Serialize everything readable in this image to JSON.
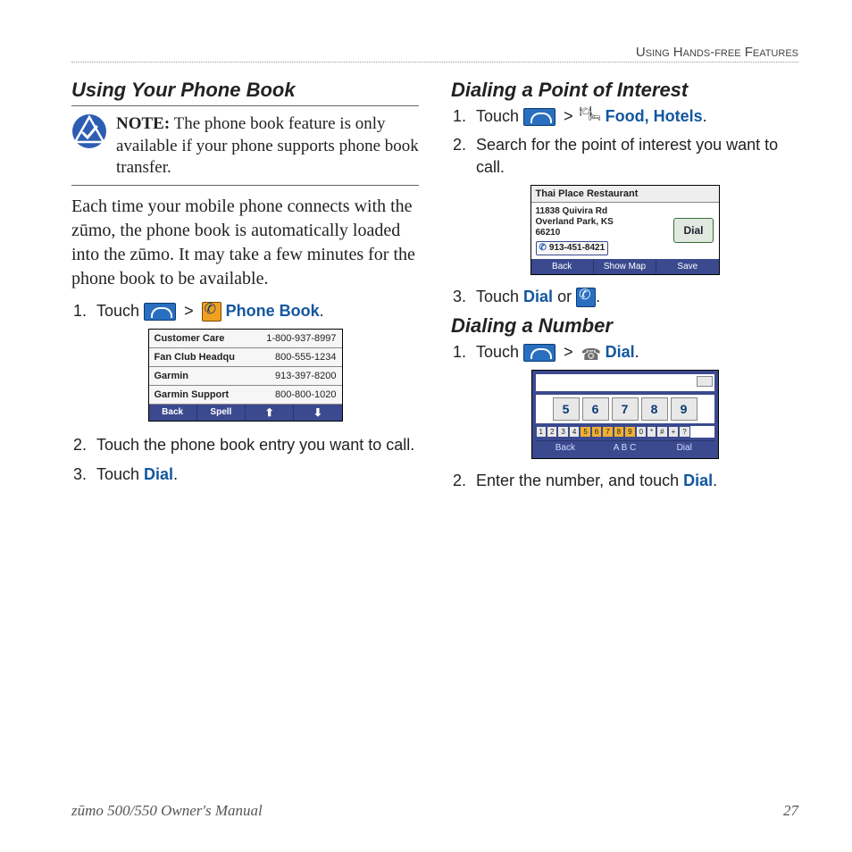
{
  "running_head": "Using Hands-free Features",
  "left": {
    "heading": "Using Your Phone Book",
    "note_label": "NOTE:",
    "note_text": " The phone book feature is only available if your phone supports phone book transfer.",
    "para": "Each time your mobile phone connects with the zūmo, the phone book is automatically loaded into the zūmo. It may take a few minutes for the phone book to be available.",
    "step1_touch": "Touch ",
    "step1_link": " Phone Book",
    "step1_period": ".",
    "step2": "Touch the phone book entry you want to call.",
    "step3_a": "Touch ",
    "step3_link": "Dial",
    "step3_b": "."
  },
  "phonebook_screenshot": {
    "rows": [
      {
        "name": "Customer Care",
        "num": "1-800-937-8997"
      },
      {
        "name": "Fan Club Headqu",
        "num": "800-555-1234"
      },
      {
        "name": "Garmin",
        "num": "913-397-8200"
      },
      {
        "name": "Garmin Support",
        "num": "800-800-1020"
      }
    ],
    "foot_back": "Back",
    "foot_spell": "Spell",
    "foot_up": "⬆",
    "foot_down": "⬇"
  },
  "right": {
    "poi_heading": "Dialing a Point of Interest",
    "poi_step1_touch": "Touch ",
    "poi_step1_link": " Food, Hotels",
    "poi_step1_period": ".",
    "poi_step2": "Search for the point of interest you want to call.",
    "poi_step3_a": "Touch ",
    "poi_step3_link": "Dial",
    "poi_step3_b": " or ",
    "poi_step3_c": ".",
    "num_heading": "Dialing a Number",
    "num_step1_touch": "Touch ",
    "num_step1_link": " Dial",
    "num_step1_period": ".",
    "num_step2_a": "Enter the number, and touch ",
    "num_step2_link": "Dial",
    "num_step2_b": "."
  },
  "poi_screenshot": {
    "title": "Thai Place Restaurant",
    "addr1": "11838 Quivira Rd",
    "addr2": "Overland Park, KS",
    "addr3": "66210",
    "phone": "913-451-8421",
    "dial": "Dial",
    "foot_back": "Back",
    "foot_map": "Show Map",
    "foot_save": "Save"
  },
  "keypad_screenshot": {
    "keys": [
      "5",
      "6",
      "7",
      "8",
      "9"
    ],
    "strip_a": [
      "1",
      "2",
      "3",
      "4"
    ],
    "strip_sel": [
      "5",
      "6",
      "7",
      "8",
      "9"
    ],
    "strip_b": [
      "0",
      "*",
      "#",
      "+",
      "?"
    ],
    "foot_back": "Back",
    "foot_abc": "A B C",
    "foot_dial": "Dial"
  },
  "footer_left": "zūmo 500/550 Owner's Manual",
  "footer_right": "27",
  "sep": ">"
}
